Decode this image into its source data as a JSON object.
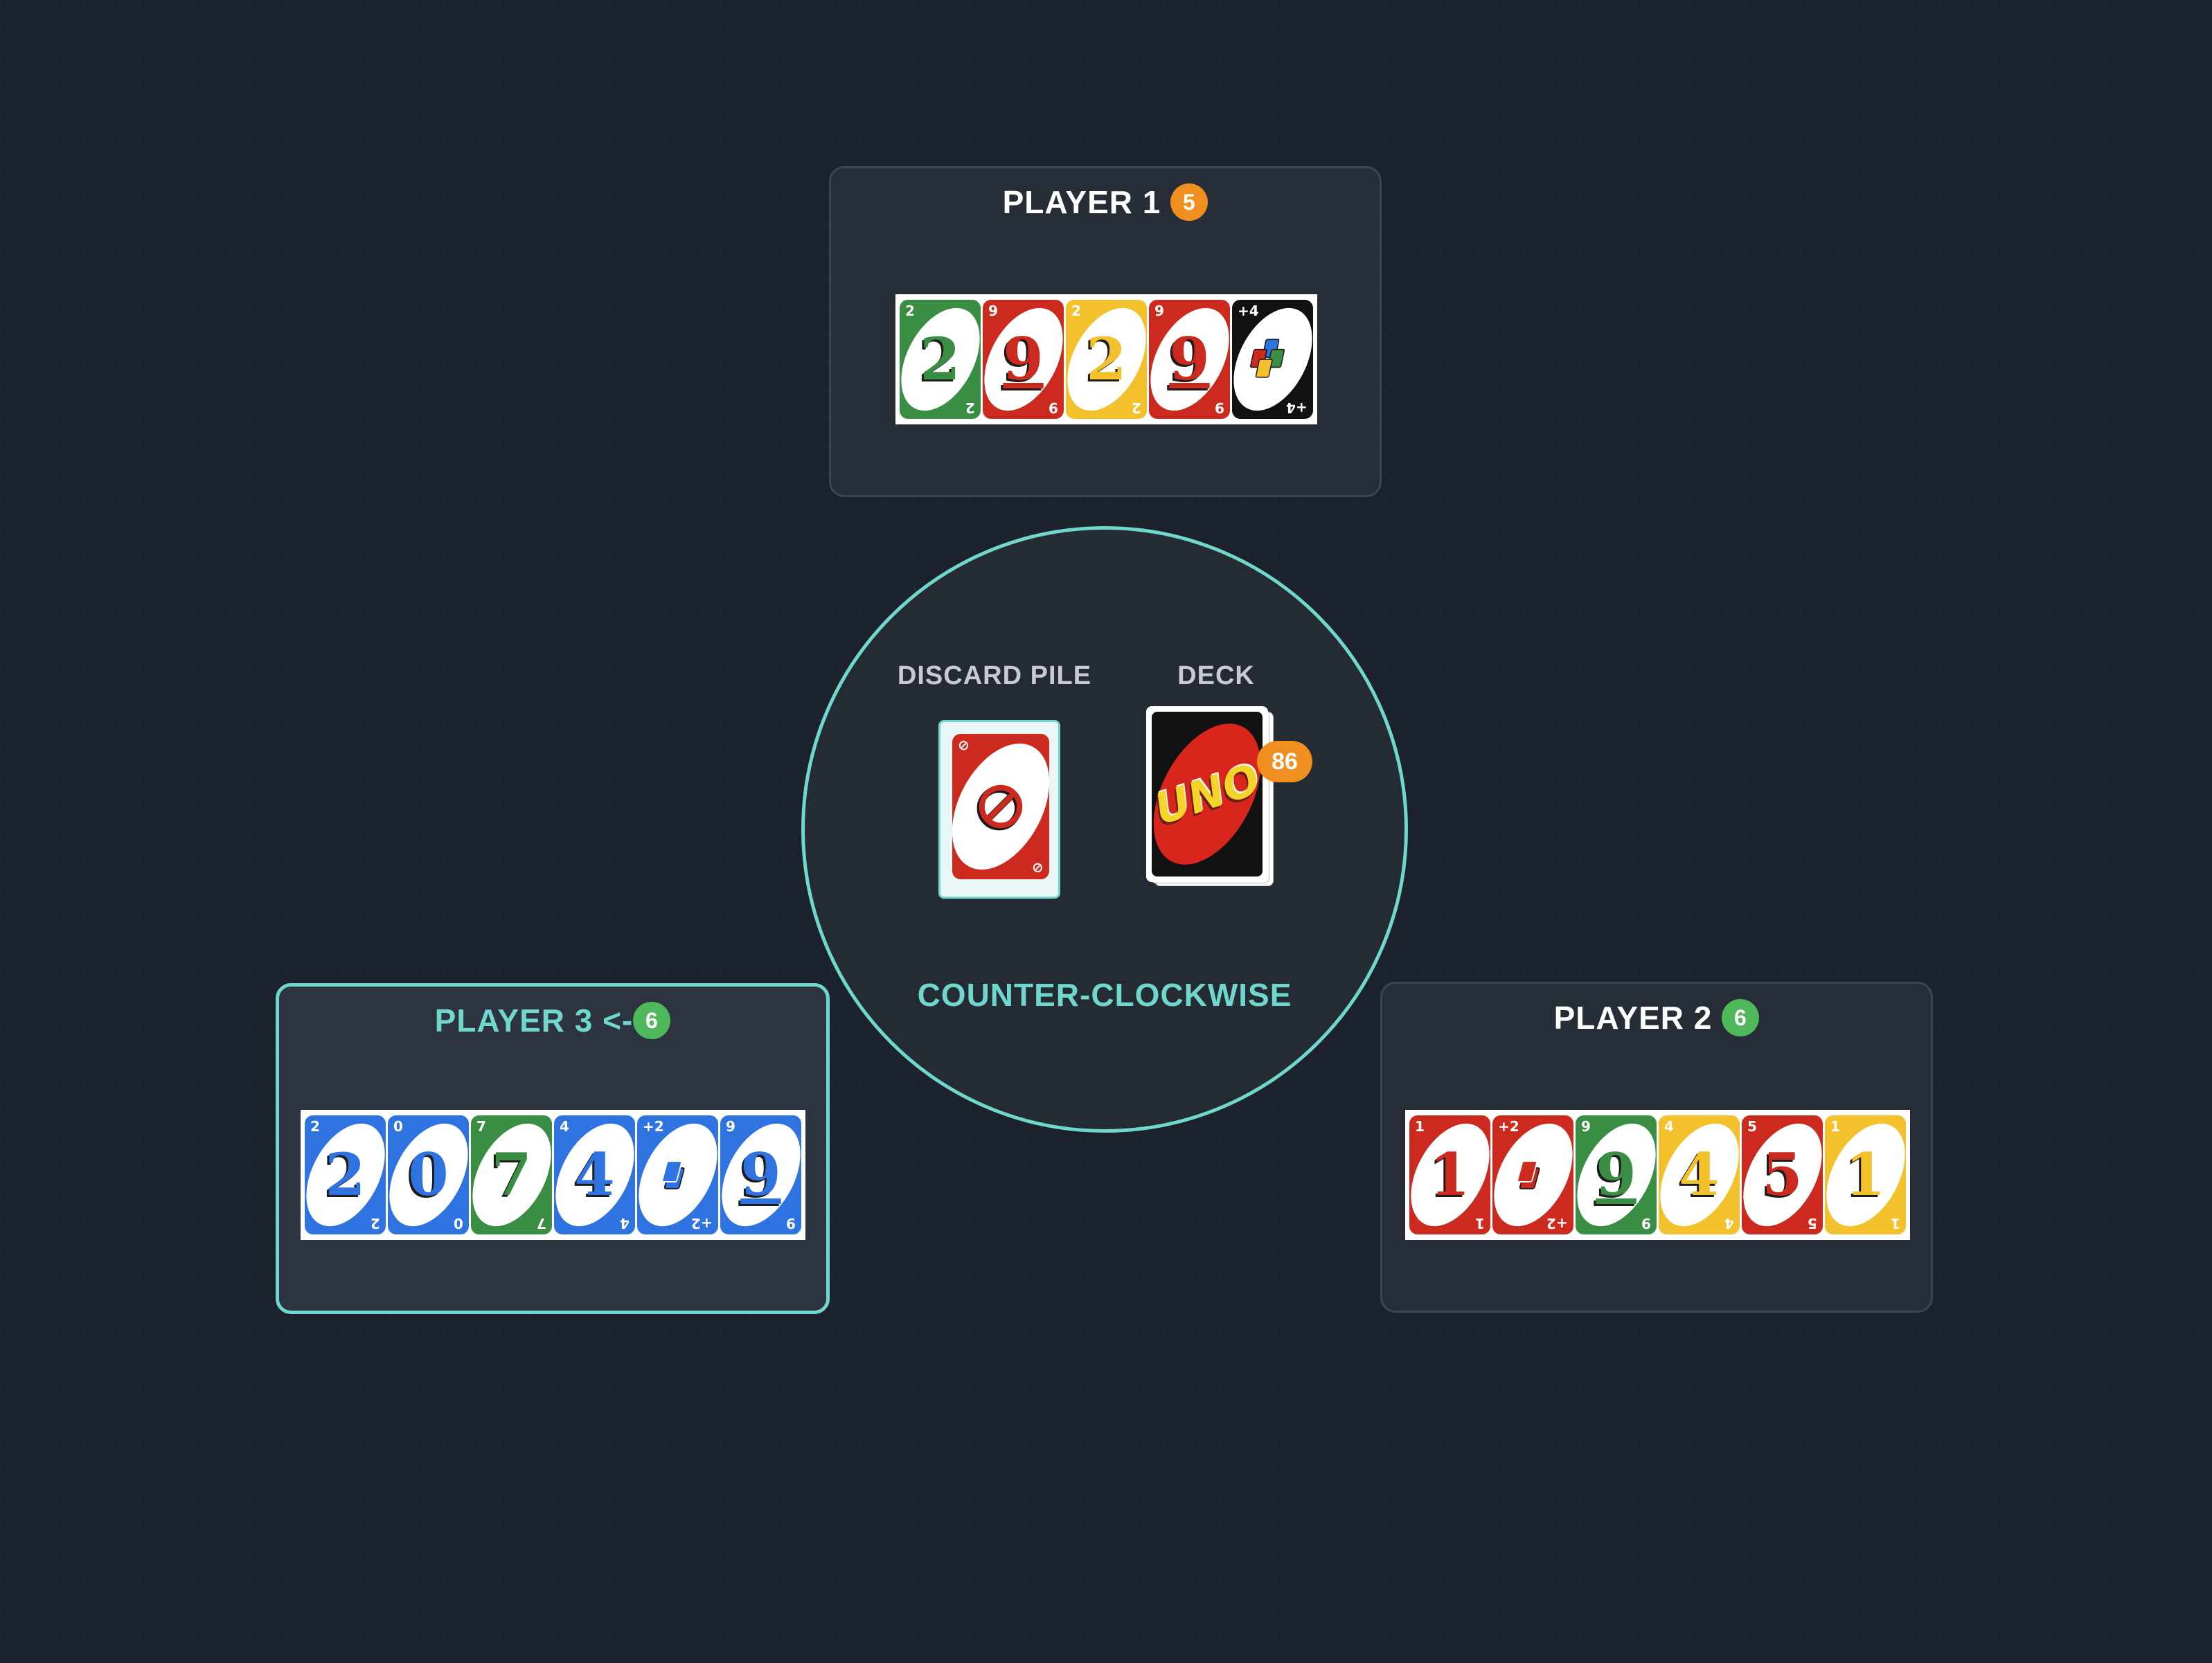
{
  "players": {
    "p1": {
      "name": "PLAYER 1",
      "count": "5",
      "cards": [
        {
          "color": "green",
          "value": "2"
        },
        {
          "color": "red",
          "value": "9"
        },
        {
          "color": "yellow",
          "value": "2"
        },
        {
          "color": "red",
          "value": "9"
        },
        {
          "color": "black",
          "value": "+4"
        }
      ]
    },
    "p2": {
      "name": "PLAYER 2",
      "count": "6",
      "cards": [
        {
          "color": "red",
          "value": "1"
        },
        {
          "color": "red",
          "value": "+2"
        },
        {
          "color": "green",
          "value": "9"
        },
        {
          "color": "yellow",
          "value": "4"
        },
        {
          "color": "red",
          "value": "5"
        },
        {
          "color": "yellow",
          "value": "1"
        }
      ]
    },
    "p3": {
      "name": "PLAYER 3 <-",
      "count": "6",
      "cards": [
        {
          "color": "blue",
          "value": "2"
        },
        {
          "color": "blue",
          "value": "0"
        },
        {
          "color": "green",
          "value": "7"
        },
        {
          "color": "blue",
          "value": "4"
        },
        {
          "color": "blue",
          "value": "+2"
        },
        {
          "color": "blue",
          "value": "9"
        }
      ]
    }
  },
  "center": {
    "discard_label": "DISCARD PILE",
    "deck_label": "DECK",
    "deck_count": "86",
    "deck_logo": "UNO",
    "discard_top": {
      "color": "red",
      "value": "skip"
    },
    "direction": "COUNTER-CLOCKWISE"
  },
  "colors": {
    "accent": "#6fd7cd",
    "red": "#cc2a1e",
    "green": "#3a8e44",
    "yellow": "#f2c12c",
    "blue": "#2f73e0",
    "badge_orange": "#f08f1f",
    "badge_green": "#4fb85a"
  }
}
